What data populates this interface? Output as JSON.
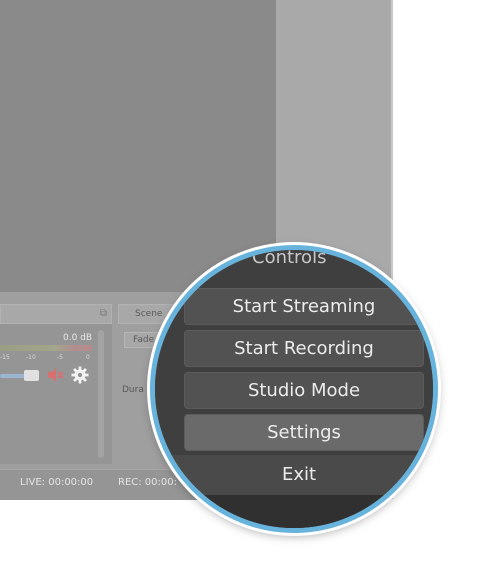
{
  "mixer": {
    "db_readout": "0.0 dB",
    "ticks": [
      "-15",
      "-10",
      "-5",
      "0"
    ]
  },
  "scenes_panel": {
    "header_label": "Scene",
    "fade_label": "Fade",
    "duration_label": "Dura"
  },
  "status_bar": {
    "live": "LIVE: 00:00:00",
    "rec": "REC: 00:00:"
  },
  "controls": {
    "title": "Controls",
    "buttons": [
      {
        "label": "Start Streaming"
      },
      {
        "label": "Start Recording"
      },
      {
        "label": "Studio Mode"
      },
      {
        "label": "Settings"
      },
      {
        "label": "Exit"
      }
    ]
  },
  "colors": {
    "magnifier_ring": "#67b3dc",
    "slider_fill": "#9ab6d1",
    "mute_icon": "#d97070"
  }
}
